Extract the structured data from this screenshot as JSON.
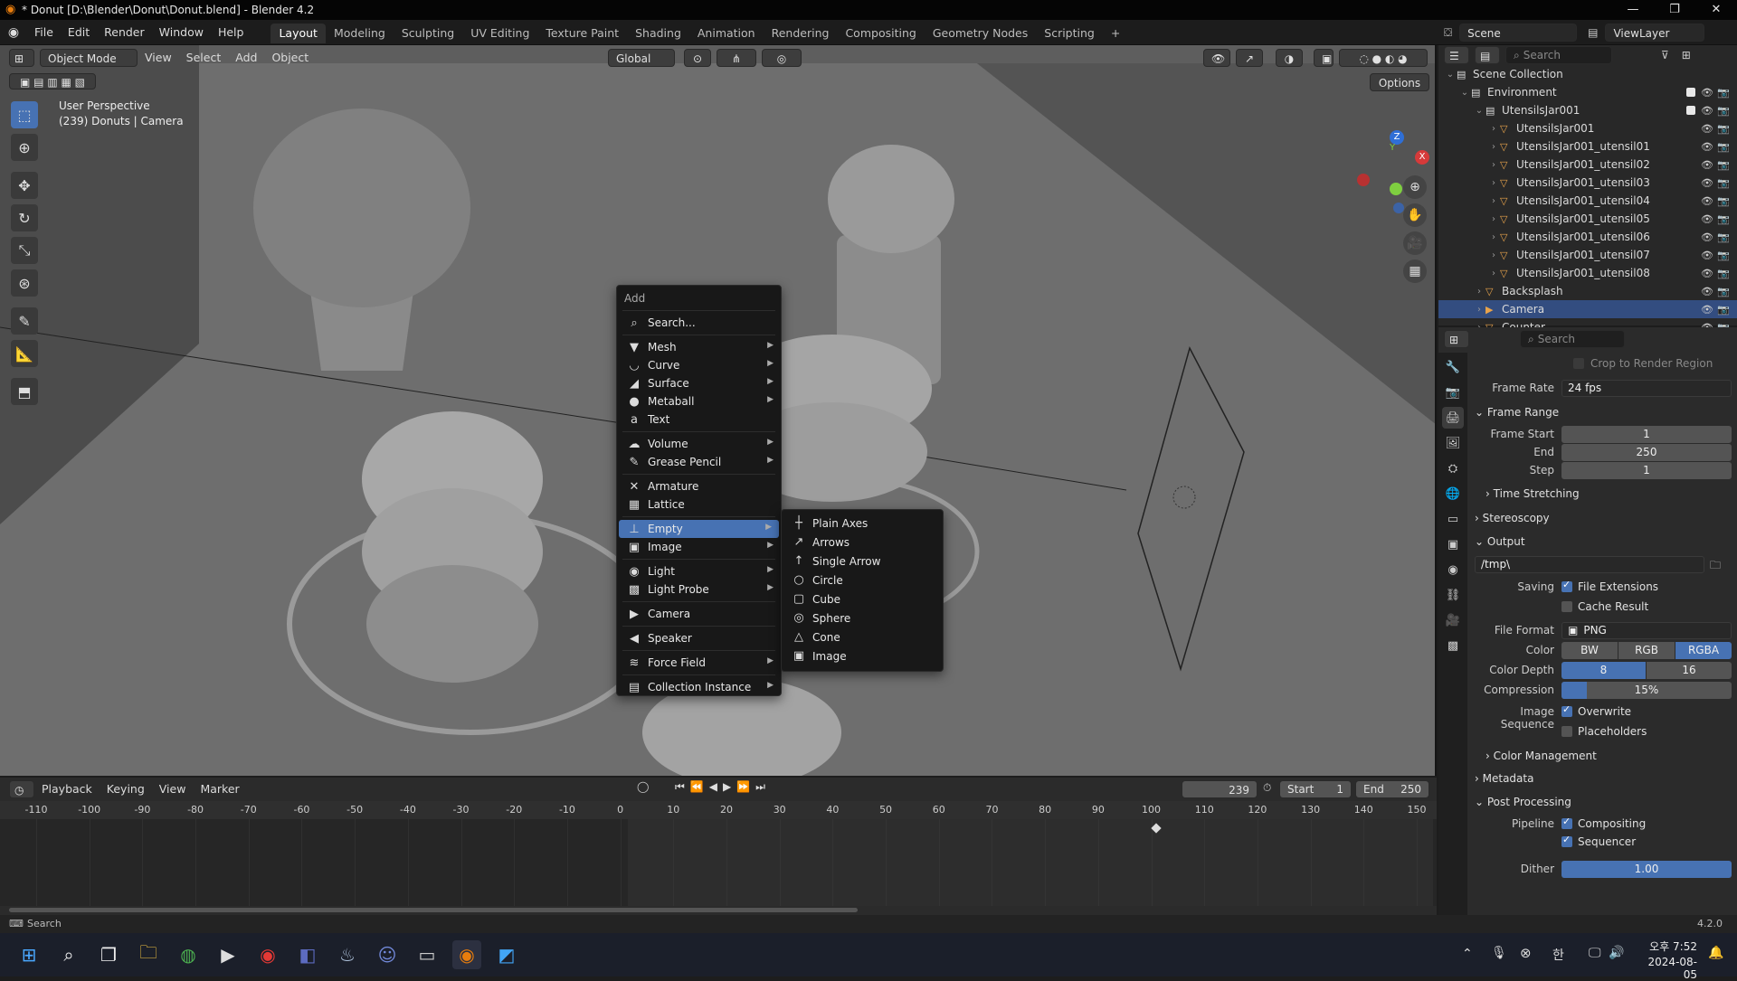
{
  "window": {
    "title": "* Donut [D:\\Blender\\Donut\\Donut.blend] - Blender 4.2",
    "minimize": "—",
    "maximize": "❐",
    "close": "✕"
  },
  "menu": [
    "File",
    "Edit",
    "Render",
    "Window",
    "Help"
  ],
  "workspaces": [
    "Layout",
    "Modeling",
    "Sculpting",
    "UV Editing",
    "Texture Paint",
    "Shading",
    "Animation",
    "Rendering",
    "Compositing",
    "Geometry Nodes",
    "Scripting"
  ],
  "workspace_add": "+",
  "scene": {
    "name": "Scene",
    "view_layer": "ViewLayer"
  },
  "viewport": {
    "mode": "Object Mode",
    "menus": [
      "View",
      "Select",
      "Add",
      "Object"
    ],
    "orientation": "Global",
    "options": "Options",
    "info_line1": "User Perspective",
    "info_line2": "(239) Donuts | Camera",
    "gizmo": {
      "z": "Z",
      "y": "Y",
      "x": "X"
    }
  },
  "add_menu": {
    "title": "Add",
    "search": "Search...",
    "items": [
      {
        "label": "Mesh",
        "icon": "▼",
        "sub": true
      },
      {
        "label": "Curve",
        "icon": "◡",
        "sub": true
      },
      {
        "label": "Surface",
        "icon": "◢",
        "sub": true
      },
      {
        "label": "Metaball",
        "icon": "●",
        "sub": true
      },
      {
        "label": "Text",
        "icon": "a",
        "sub": false
      },
      {
        "label": "Volume",
        "icon": "☁",
        "sub": true
      },
      {
        "label": "Grease Pencil",
        "icon": "✎",
        "sub": true
      },
      {
        "label": "Armature",
        "icon": "✕",
        "sub": false
      },
      {
        "label": "Lattice",
        "icon": "▦",
        "sub": false
      },
      {
        "label": "Empty",
        "icon": "⊥",
        "sub": true
      },
      {
        "label": "Image",
        "icon": "▣",
        "sub": true
      },
      {
        "label": "Light",
        "icon": "◉",
        "sub": true
      },
      {
        "label": "Light Probe",
        "icon": "▩",
        "sub": true
      },
      {
        "label": "Camera",
        "icon": "▶",
        "sub": false
      },
      {
        "label": "Speaker",
        "icon": "◀",
        "sub": false
      },
      {
        "label": "Force Field",
        "icon": "≋",
        "sub": true
      },
      {
        "label": "Collection Instance",
        "icon": "▤",
        "sub": true
      }
    ]
  },
  "empty_menu": [
    {
      "label": "Plain Axes",
      "icon": "┼"
    },
    {
      "label": "Arrows",
      "icon": "↗"
    },
    {
      "label": "Single Arrow",
      "icon": "↑"
    },
    {
      "label": "Circle",
      "icon": "○"
    },
    {
      "label": "Cube",
      "icon": "▢"
    },
    {
      "label": "Sphere",
      "icon": "◎"
    },
    {
      "label": "Cone",
      "icon": "△"
    },
    {
      "label": "Image",
      "icon": "▣"
    }
  ],
  "timeline": {
    "menus": [
      "Playback",
      "Keying",
      "View",
      "Marker"
    ],
    "current_frame": "239",
    "start_label": "Start",
    "start": "1",
    "end_label": "End",
    "end": "250",
    "ticks": [
      "-110",
      "-100",
      "-90",
      "-80",
      "-70",
      "-60",
      "-50",
      "-40",
      "-30",
      "-20",
      "-10",
      "0",
      "10",
      "20",
      "30",
      "40",
      "50",
      "60",
      "70",
      "80",
      "90",
      "100",
      "110",
      "120",
      "130",
      "140",
      "150"
    ]
  },
  "outliner": {
    "search_placeholder": "Search",
    "rows": [
      {
        "label": "Scene Collection",
        "indent": 0
      },
      {
        "label": "Environment",
        "indent": 1
      },
      {
        "label": "UtensilsJar001",
        "indent": 2
      },
      {
        "label": "UtensilsJar001",
        "indent": 3
      },
      {
        "label": "UtensilsJar001_utensil01",
        "indent": 3
      },
      {
        "label": "UtensilsJar001_utensil02",
        "indent": 3
      },
      {
        "label": "UtensilsJar001_utensil03",
        "indent": 3
      },
      {
        "label": "UtensilsJar001_utensil04",
        "indent": 3
      },
      {
        "label": "UtensilsJar001_utensil05",
        "indent": 3
      },
      {
        "label": "UtensilsJar001_utensil06",
        "indent": 3
      },
      {
        "label": "UtensilsJar001_utensil07",
        "indent": 3
      },
      {
        "label": "UtensilsJar001_utensil08",
        "indent": 3
      },
      {
        "label": "Backsplash",
        "indent": 2
      },
      {
        "label": "Camera",
        "indent": 2
      },
      {
        "label": "Counter",
        "indent": 2
      }
    ]
  },
  "properties": {
    "search_placeholder": "Search",
    "crop": "Crop to Render Region",
    "frame_rate_label": "Frame Rate",
    "frame_rate": "24 fps",
    "frame_range": "Frame Range",
    "frame_start_label": "Frame Start",
    "frame_start": "1",
    "end_label": "End",
    "end": "250",
    "step_label": "Step",
    "step": "1",
    "time_stretching": "Time Stretching",
    "stereoscopy": "Stereoscopy",
    "output": "Output",
    "path": "/tmp\\",
    "saving_label": "Saving",
    "file_extensions": "File Extensions",
    "cache_result": "Cache Result",
    "file_format_label": "File Format",
    "file_format": "PNG",
    "color_label": "Color",
    "color_opts": [
      "BW",
      "RGB",
      "RGBA"
    ],
    "color_depth_label": "Color Depth",
    "depth_opts": [
      "8",
      "16"
    ],
    "compression_label": "Compression",
    "compression": "15%",
    "compression_fraction": 0.15,
    "image_sequence_label": "Image Sequence",
    "overwrite": "Overwrite",
    "placeholders": "Placeholders",
    "color_management": "Color Management",
    "metadata": "Metadata",
    "post_processing": "Post Processing",
    "pipeline_label": "Pipeline",
    "compositing": "Compositing",
    "sequencer": "Sequencer",
    "dither_label": "Dither",
    "dither": "1.00"
  },
  "status": {
    "search": "Search",
    "version": "4.2.0"
  },
  "taskbar": {
    "time": "오후 7:52",
    "date": "2024-08-05",
    "ime": "한"
  }
}
